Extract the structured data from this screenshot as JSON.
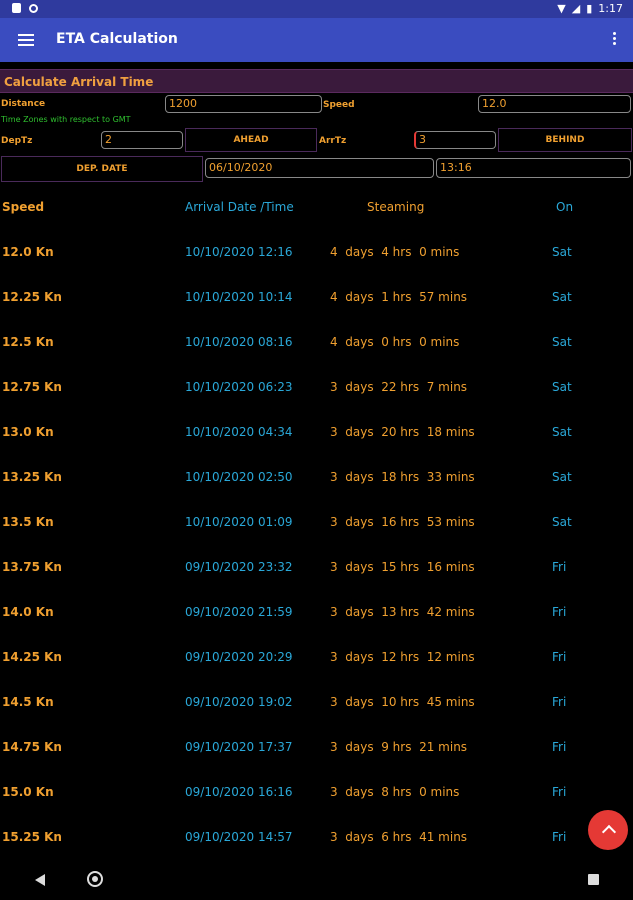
{
  "status": {
    "time": "1:17"
  },
  "app": {
    "title": "ETA Calculation"
  },
  "section": {
    "title": "Calculate Arrival Time"
  },
  "form": {
    "distance_label": "Distance",
    "distance_value": "1200",
    "speed_label": "Speed",
    "speed_value": "12.0",
    "tz_note": "Time Zones with respect to GMT",
    "deptz_label": "DepTz",
    "deptz_value": "2",
    "ahead_button": "AHEAD",
    "arrtz_label": "ArrTz",
    "arrtz_value": "3",
    "behind_button": "BEHIND",
    "depdate_button": "DEP. DATE",
    "date_value": "06/10/2020",
    "time_value": "13:16"
  },
  "table": {
    "headers": {
      "speed": "Speed",
      "arrival": "Arrival Date /Time",
      "steaming": "Steaming",
      "on": "On"
    },
    "rows": [
      {
        "speed": "12.0 Kn",
        "arrival": "10/10/2020 12:16",
        "steaming": "4  days  4 hrs  0 mins",
        "on": "Sat"
      },
      {
        "speed": "12.25 Kn",
        "arrival": "10/10/2020 10:14",
        "steaming": "4  days  1 hrs  57 mins",
        "on": "Sat"
      },
      {
        "speed": "12.5 Kn",
        "arrival": "10/10/2020 08:16",
        "steaming": "4  days  0 hrs  0 mins",
        "on": "Sat"
      },
      {
        "speed": "12.75 Kn",
        "arrival": "10/10/2020 06:23",
        "steaming": "3  days  22 hrs  7 mins",
        "on": "Sat"
      },
      {
        "speed": "13.0 Kn",
        "arrival": "10/10/2020 04:34",
        "steaming": "3  days  20 hrs  18 mins",
        "on": "Sat"
      },
      {
        "speed": "13.25 Kn",
        "arrival": "10/10/2020 02:50",
        "steaming": "3  days  18 hrs  33 mins",
        "on": "Sat"
      },
      {
        "speed": "13.5 Kn",
        "arrival": "10/10/2020 01:09",
        "steaming": "3  days  16 hrs  53 mins",
        "on": "Sat"
      },
      {
        "speed": "13.75 Kn",
        "arrival": "09/10/2020 23:32",
        "steaming": "3  days  15 hrs  16 mins",
        "on": "Fri"
      },
      {
        "speed": "14.0 Kn",
        "arrival": "09/10/2020 21:59",
        "steaming": "3  days  13 hrs  42 mins",
        "on": "Fri"
      },
      {
        "speed": "14.25 Kn",
        "arrival": "09/10/2020 20:29",
        "steaming": "3  days  12 hrs  12 mins",
        "on": "Fri"
      },
      {
        "speed": "14.5 Kn",
        "arrival": "09/10/2020 19:02",
        "steaming": "3  days  10 hrs  45 mins",
        "on": "Fri"
      },
      {
        "speed": "14.75 Kn",
        "arrival": "09/10/2020 17:37",
        "steaming": "3  days  9 hrs  21 mins",
        "on": "Fri"
      },
      {
        "speed": "15.0 Kn",
        "arrival": "09/10/2020 16:16",
        "steaming": "3  days  8 hrs  0 mins",
        "on": "Fri"
      },
      {
        "speed": "15.25 Kn",
        "arrival": "09/10/2020 14:57",
        "steaming": "3  days  6 hrs  41 mins",
        "on": "Fri"
      }
    ]
  },
  "colors": {
    "appbar": "#3a4cc0",
    "accent": "#f0a030",
    "link": "#2aa8d8",
    "fab": "#e53935"
  },
  "icons": {
    "menu": "menu-icon",
    "more": "more-vert-icon",
    "fab": "chevron-up-icon"
  }
}
